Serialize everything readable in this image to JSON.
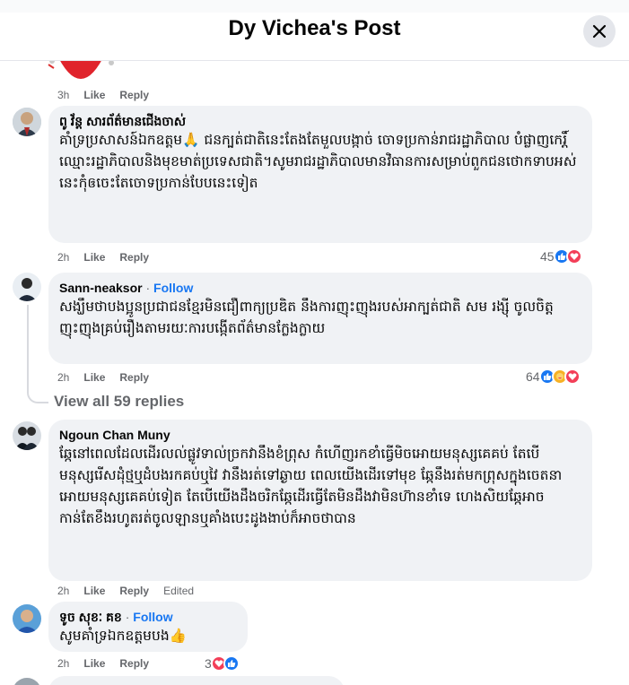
{
  "header": {
    "title": "Dy Vichea's Post",
    "close_icon": "close-icon"
  },
  "top_meta": {
    "time": "3h",
    "like": "Like",
    "reply": "Reply"
  },
  "comments": [
    {
      "author": "ពូ វ័ន្ត សារព័ត៌មានជើងចាស់",
      "text": "គាំទ្រប្រសាសន៍ឯកឧត្តម🙏 ជនក្បត់ជាតិនេះតែងតែមួលបង្កាច់ ចោទប្រកាន់រាជរដ្ឋាភិបាល បំផ្លាញកេរ្តិ៍ឈ្មោះរដ្ឋាភិបាលនិងមុខមាត់ប្រទេសជាតិ។សូមរាជរដ្ឋាភិបាលមានវិធានការសម្រាប់ពួកជនថោកទាបអស់នេះកុំឲចេះតែចោទប្រកាន់បែបនេះទៀត",
      "time": "2h",
      "like": "Like",
      "reply": "Reply",
      "reaction_count": "45"
    },
    {
      "author": "Sann-neaksor",
      "separator": " · ",
      "follow": "Follow",
      "text": "សង្ឃឹមថាបងប្អូនប្រជាជនខ្មែរមិនជឿពាក្យប្រឌិត នឹងការញុះញុងរបស់អាក្បត់ជាតិ សម រង្ស៊ី ចូលចិត្តញុះញុងគ្រប់រឿងតាមរយៈការបង្កើតព័ត៌មានក្លែងក្លាយ",
      "time": "2h",
      "like": "Like",
      "reply": "Reply",
      "reaction_count": "64"
    }
  ],
  "view_replies": "View all 59 replies",
  "comments2": [
    {
      "author": "Ngoun Chan Muny",
      "text": "ឆ្កែនៅពេលដែលដើរលល់ផ្លូវទាល់ច្រកវានឹងខំព្រុស កំហើញរកខាំធ្វើមិចអោយមនុស្សគេគប់ តែបើមនុស្សរើសដុំថ្មឬដំបងរកគប់ឬវៃ វានឹងរត់ទៅឆ្ងាយ ពេលយើងដើរទៅមុខ ឆ្កែនឹងរត់មកព្រុសក្នុងចេតនាអោយមនុស្សគេគប់ទៀត តែបើយើងដឹងចរិកឆ្កែដើរធ្វើតែមិនដឹងវាមិនហ៊ានខាំទេ ហេងសិយឆ្កែអាចកាន់តែខឹងរហូតរត់ចូលឡានឬគាំងបេះដូងងាប់ក៏អាចថាបាន",
      "time": "2h",
      "like": "Like",
      "reply": "Reply",
      "edited": "Edited"
    },
    {
      "author": "ទូច សុខៈ គខ",
      "separator": " · ",
      "follow": "Follow",
      "text": "សូមគាំទ្រឯកឧត្តមបង👍",
      "time": "2h",
      "like": "Like",
      "reply": "Reply",
      "reaction_count": "3"
    }
  ],
  "colors": {
    "bubble": "#f0f2f5",
    "link": "#1877f2",
    "meta": "#65676b",
    "like": "#1877f2",
    "love": "#f33e58",
    "care": "#f7b125"
  }
}
